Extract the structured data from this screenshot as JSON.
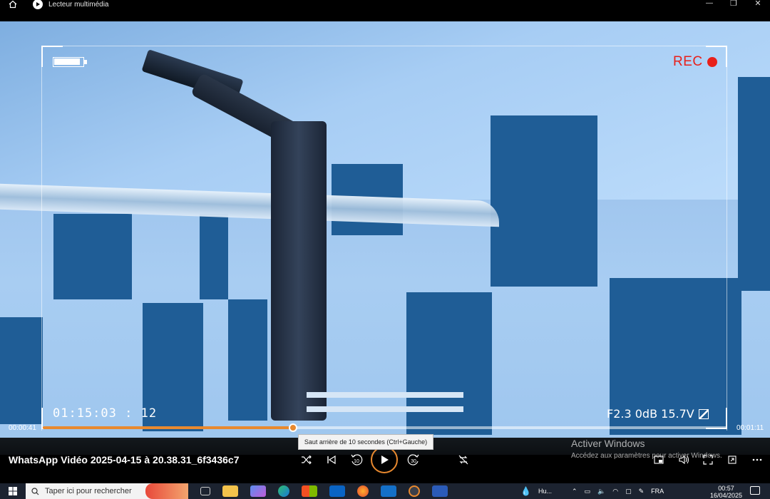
{
  "window": {
    "title": "Lecteur multimédia",
    "minimize_glyph": "—",
    "maximize_glyph": "❐",
    "close_glyph": "✕"
  },
  "overlay": {
    "rec_label": "REC",
    "timecode": "01:15:03 : 12",
    "camera_info": "F2.3  0dB 15.7V",
    "rec_color": "#e8201a"
  },
  "playback": {
    "elapsed": "00:00:41",
    "total": "00:01:11",
    "progress": 0.366,
    "accent_color": "#e8892f",
    "tooltip": "Saut arrière de 10 secondes (Ctrl+Gauche)",
    "skip_back_label": "10",
    "skip_forward_label": "30"
  },
  "media": {
    "title": "WhatsApp Vidéo 2025-04-15 à 20.38.31_6f3436c7"
  },
  "watermark": {
    "title": "Activer Windows",
    "subtitle": "Accédez aux paramètres pour activer Windows."
  },
  "taskbar": {
    "search_placeholder": "Taper ici pour rechercher",
    "weather_label": "Hu...",
    "language": "FRA",
    "time": "00:57",
    "date": "16/04/2025"
  },
  "icons": [
    "home-icon",
    "app-icon",
    "shuffle-icon",
    "previous-icon",
    "skip-back-icon",
    "play-icon",
    "skip-forward-icon",
    "repeat-off-icon",
    "volume-icon",
    "cast-icon",
    "fullscreen-icon",
    "more-icon"
  ]
}
